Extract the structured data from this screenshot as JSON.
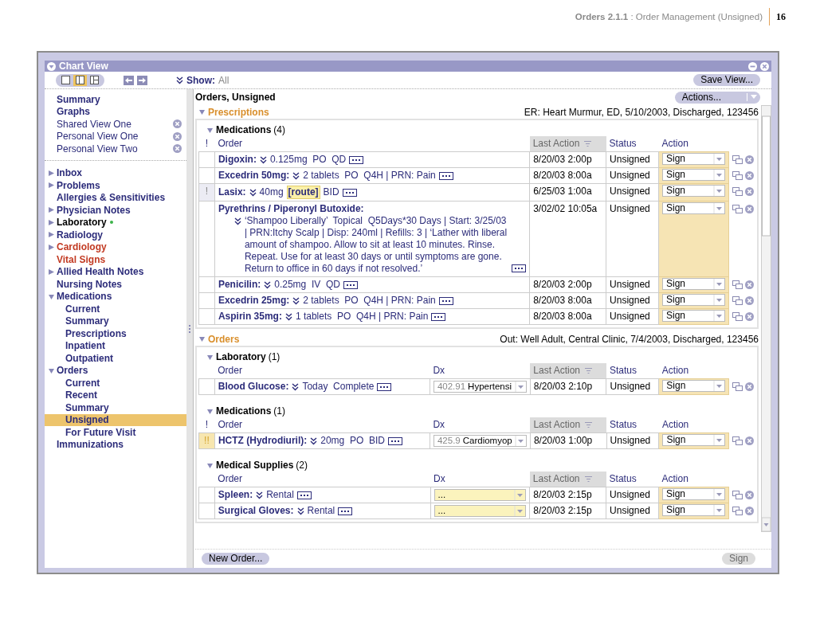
{
  "doc_header": {
    "title": "**Orders 2.1.1** : Order Management (Unsigned)",
    "page_number": "16"
  },
  "window": {
    "title": "Chart View"
  },
  "toolbar": {
    "layouts": [
      {
        "kind": "single",
        "selected": false
      },
      {
        "kind": "double",
        "selected": true
      },
      {
        "kind": "triple",
        "selected": false
      }
    ],
    "show_label": "Show:",
    "show_value": "All",
    "save_button": "Save View..."
  },
  "sidebar": {
    "views": [
      {
        "label": "Summary",
        "removable": false
      },
      {
        "label": "Graphs",
        "removable": false
      },
      {
        "label": "Shared View One",
        "removable": true
      },
      {
        "label": "Personal View One",
        "removable": true
      },
      {
        "label": "Personal View Two",
        "removable": true
      }
    ],
    "items": [
      {
        "label": "Inbox",
        "expanded": false,
        "alert": false,
        "updated": false,
        "selected": false
      },
      {
        "label": "Problems",
        "expanded": false,
        "alert": false,
        "updated": false,
        "selected": false
      },
      {
        "label": "Allergies & Sensitivities",
        "alert": false,
        "updated": false,
        "selected": false
      },
      {
        "label": "Physician Notes",
        "expanded": false,
        "alert": false,
        "updated": false,
        "selected": false
      },
      {
        "label": "Laboratory",
        "expanded": false,
        "alert": false,
        "updated": true,
        "selected": false
      },
      {
        "label": "Radiology",
        "expanded": false,
        "alert": false,
        "updated": false,
        "selected": false
      },
      {
        "label": "Cardiology",
        "expanded": false,
        "alert": true,
        "updated": false,
        "selected": false
      },
      {
        "label": "Vital Signs",
        "alert": true,
        "updated": false,
        "selected": false
      },
      {
        "label": "Allied Health Notes",
        "expanded": false,
        "alert": false,
        "updated": false,
        "selected": false
      },
      {
        "label": "Nursing Notes",
        "alert": false,
        "updated": false,
        "selected": false
      },
      {
        "label": "Medications",
        "expanded": true,
        "alert": false,
        "updated": false,
        "selected": false,
        "children": [
          {
            "label": "Current",
            "selected": false
          },
          {
            "label": "Summary",
            "selected": false
          },
          {
            "label": "Prescriptions",
            "selected": false
          },
          {
            "label": "Inpatient",
            "selected": false
          },
          {
            "label": "Outpatient",
            "selected": false
          }
        ]
      },
      {
        "label": "Orders",
        "expanded": true,
        "alert": false,
        "updated": false,
        "selected": false,
        "children": [
          {
            "label": "Current",
            "selected": false
          },
          {
            "label": "Recent",
            "selected": false
          },
          {
            "label": "Summary",
            "selected": false
          },
          {
            "label": "Unsigned",
            "selected": true
          },
          {
            "label": "For Future Visit",
            "selected": false
          }
        ]
      },
      {
        "label": "Immunizations",
        "alert": false,
        "updated": false,
        "selected": false
      }
    ]
  },
  "main": {
    "title": "Orders, Unsigned",
    "actions_button": "Actions...",
    "sections": [
      {
        "title": "Prescriptions",
        "expanded": true,
        "encounter": "ER: Heart Murmur, ED, 5/10/2003, Discharged, 123456",
        "groups": [
          {
            "title": "Medications",
            "count": "(4)",
            "expanded": true,
            "columns": [
              {
                "kind": "flag",
                "label": "!",
                "sorted": false
              },
              {
                "kind": "order",
                "label": "Order",
                "sorted": false
              },
              {
                "kind": "last_action",
                "label": "Last Action",
                "sorted": true
              },
              {
                "kind": "status",
                "label": "Status",
                "sorted": false
              },
              {
                "kind": "action",
                "label": "Action",
                "sorted": false
              }
            ],
            "rows": [
              {
                "name": "Digoxin:",
                "details": "0.125mg  PO  QD",
                "last_action": "8/20/03 2:00p",
                "status": "Unsigned",
                "action": "Sign"
              },
              {
                "name": "Excedrin 50mg:",
                "details": "2 tablets  PO  Q4H | PRN: Pain",
                "last_action": "8/20/03 8:00a",
                "status": "Unsigned",
                "action": "Sign"
              },
              {
                "name": "Lasix:",
                "flag": "!",
                "urgent": false,
                "details": [
                  {
                    "text": "40mg",
                    "missing": false
                  },
                  {
                    "text": "[route]",
                    "missing": true
                  },
                  {
                    "text": "BID",
                    "missing": false
                  }
                ],
                "last_action": "6/25/03 1:00a",
                "status": "Unsigned",
                "action": "Sign"
              },
              {
                "name": "Pyrethrins / Piperonyl Butoxide:",
                "kind": "long",
                "details": "‘Shampoo Liberally’  Topical  Q5Days*30 Days | Start: 3/25/03 | PRN:Itchy Scalp | Disp: 240ml | Refills: 3 | ‘Lather with liberal amount of shampoo. Allow to sit at least 10 minutes. Rinse. Repeat. Use for at least 30 days or until symptoms are gone. Return to office in 60 days if not resolved.’",
                "last_action": "3/02/02 10:05a",
                "status": "Unsigned",
                "action": "Sign"
              },
              {
                "name": "Penicilin:",
                "details": "0.25mg  IV  QD",
                "last_action": "8/20/03 2:00p",
                "status": "Unsigned",
                "action": "Sign"
              },
              {
                "name": "Excedrin 25mg:",
                "details": "2 tablets  PO  Q4H | PRN: Pain",
                "last_action": "8/20/03 8:00a",
                "status": "Unsigned",
                "action": "Sign"
              },
              {
                "name": "Aspirin 35mg:",
                "details": "1 tablets  PO  Q4H | PRN: Pain",
                "last_action": "8/20/03 8:00a",
                "status": "Unsigned",
                "action": "Sign"
              }
            ]
          }
        ]
      },
      {
        "title": "Orders",
        "expanded": true,
        "encounter": "Out: Well Adult, Central Clinic, 7/4/2003, Discharged, 123456",
        "groups": [
          {
            "title": "Laboratory",
            "count": "(1)",
            "expanded": true,
            "columns": [
              {
                "kind": "flag",
                "sorted": false
              },
              {
                "kind": "order",
                "label": "Order",
                "sorted": false
              },
              {
                "kind": "dx",
                "label": "Dx",
                "sorted": false
              },
              {
                "kind": "last_action",
                "label": "Last Action",
                "sorted": true
              },
              {
                "kind": "status",
                "label": "Status",
                "sorted": false
              },
              {
                "kind": "action",
                "label": "Action",
                "sorted": false
              }
            ],
            "rows": [
              {
                "name": "Blood Glucose:",
                "details": "Today  Complete",
                "dx": {
                  "code": "402.91",
                  "text": "Hypertensi",
                  "missing": false
                },
                "last_action": "8/20/03 2:10p",
                "status": "Unsigned",
                "action": "Sign"
              }
            ]
          },
          {
            "title": "Medications",
            "count": "(1)",
            "expanded": true,
            "columns": [
              {
                "kind": "flag",
                "label": "!",
                "sorted": false
              },
              {
                "kind": "order",
                "label": "Order",
                "sorted": false
              },
              {
                "kind": "dx",
                "label": "Dx",
                "sorted": false
              },
              {
                "kind": "last_action",
                "label": "Last Action",
                "sorted": true
              },
              {
                "kind": "status",
                "label": "Status",
                "sorted": false
              },
              {
                "kind": "action",
                "label": "Action",
                "sorted": false
              }
            ],
            "rows": [
              {
                "name": "HCTZ (Hydrodiuril):",
                "flag": "!!",
                "urgent": true,
                "details": "20mg  PO  BID",
                "dx": {
                  "code": "425.9",
                  "text": "Cardiomyop",
                  "missing": false
                },
                "last_action": "8/20/03 1:00p",
                "status": "Unsigned",
                "action": "Sign"
              }
            ]
          },
          {
            "title": "Medical Supplies",
            "count": "(2)",
            "expanded": true,
            "columns": [
              {
                "kind": "flag",
                "sorted": false
              },
              {
                "kind": "order",
                "label": "Order",
                "sorted": false
              },
              {
                "kind": "dx",
                "label": "Dx",
                "sorted": false
              },
              {
                "kind": "last_action",
                "label": "Last Action",
                "sorted": true
              },
              {
                "kind": "status",
                "label": "Status",
                "sorted": false
              },
              {
                "kind": "action",
                "label": "Action",
                "sorted": false
              }
            ],
            "rows": [
              {
                "name": "Spleen:",
                "details": "Rental",
                "dx": {
                  "text": "...",
                  "missing": true
                },
                "last_action": "8/20/03 2:15p",
                "status": "Unsigned",
                "action": "Sign"
              },
              {
                "name": "Surgical Gloves:",
                "details": "Rental",
                "dx": {
                  "text": "...",
                  "missing": true
                },
                "last_action": "8/20/03 2:15p",
                "status": "Unsigned",
                "action": "Sign"
              }
            ]
          }
        ]
      }
    ]
  },
  "footer": {
    "new_order_button": "New Order...",
    "sign_button": {
      "label": "Sign",
      "disabled": true
    }
  }
}
